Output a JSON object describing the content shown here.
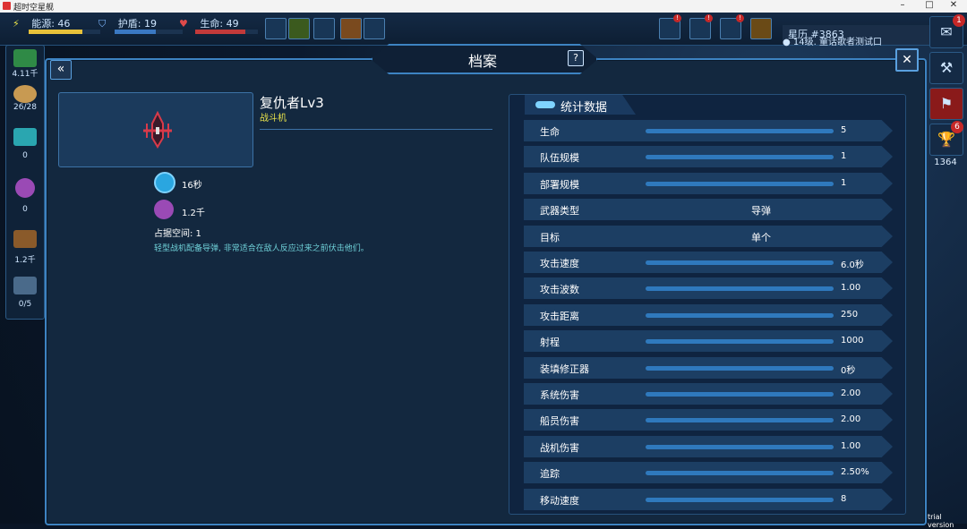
{
  "window": {
    "title": "超时空星舰"
  },
  "hud": {
    "energy": "能源: 46",
    "shield": "护盾: 19",
    "life": "生命: 49",
    "stardate": "星历 #3863",
    "ticker": "14级. 童话歌者测试口"
  },
  "left_rail": {
    "credits": "4.11千",
    "crew": "26/28",
    "crystal": "0",
    "orb": "0",
    "cargo": "1.2千",
    "hangar": "0/5"
  },
  "right_rail": {
    "chat_badge": "1",
    "trophy_badge": "6",
    "trophy_count": "1364"
  },
  "dialog": {
    "title": "档案",
    "help": "?",
    "unit": {
      "name": "复仇者Lv3",
      "type": "战斗机",
      "build_time": "16秒",
      "cost": "1.2千",
      "space": "占据空间: 1",
      "description": "轻型战机配备导弹, 非常适合在敌人反应过来之前伏击他们。"
    }
  },
  "stats": {
    "title": "统计数据",
    "rows": [
      {
        "label": "生命",
        "value": "5"
      },
      {
        "label": "队伍规模",
        "value": "1"
      },
      {
        "label": "部署规模",
        "value": "1"
      },
      {
        "label": "武器类型",
        "value": "导弹"
      },
      {
        "label": "目标",
        "value": "单个"
      },
      {
        "label": "攻击速度",
        "value": "6.0秒"
      },
      {
        "label": "攻击波数",
        "value": "1.00"
      },
      {
        "label": "攻击距离",
        "value": "250"
      },
      {
        "label": "射程",
        "value": "1000"
      },
      {
        "label": "装填修正器",
        "value": "0秒"
      },
      {
        "label": "系统伤害",
        "value": "2.00"
      },
      {
        "label": "船员伤害",
        "value": "2.00"
      },
      {
        "label": "战机伤害",
        "value": "1.00"
      },
      {
        "label": "追踪",
        "value": "2.50%"
      },
      {
        "label": "移动速度",
        "value": "8"
      }
    ]
  },
  "footer": {
    "trial": "trial version"
  },
  "colors": {
    "accent": "#3d83c2",
    "panel": "#13283f",
    "highlight": "#e8e24a",
    "desc": "#6fd1d8"
  }
}
